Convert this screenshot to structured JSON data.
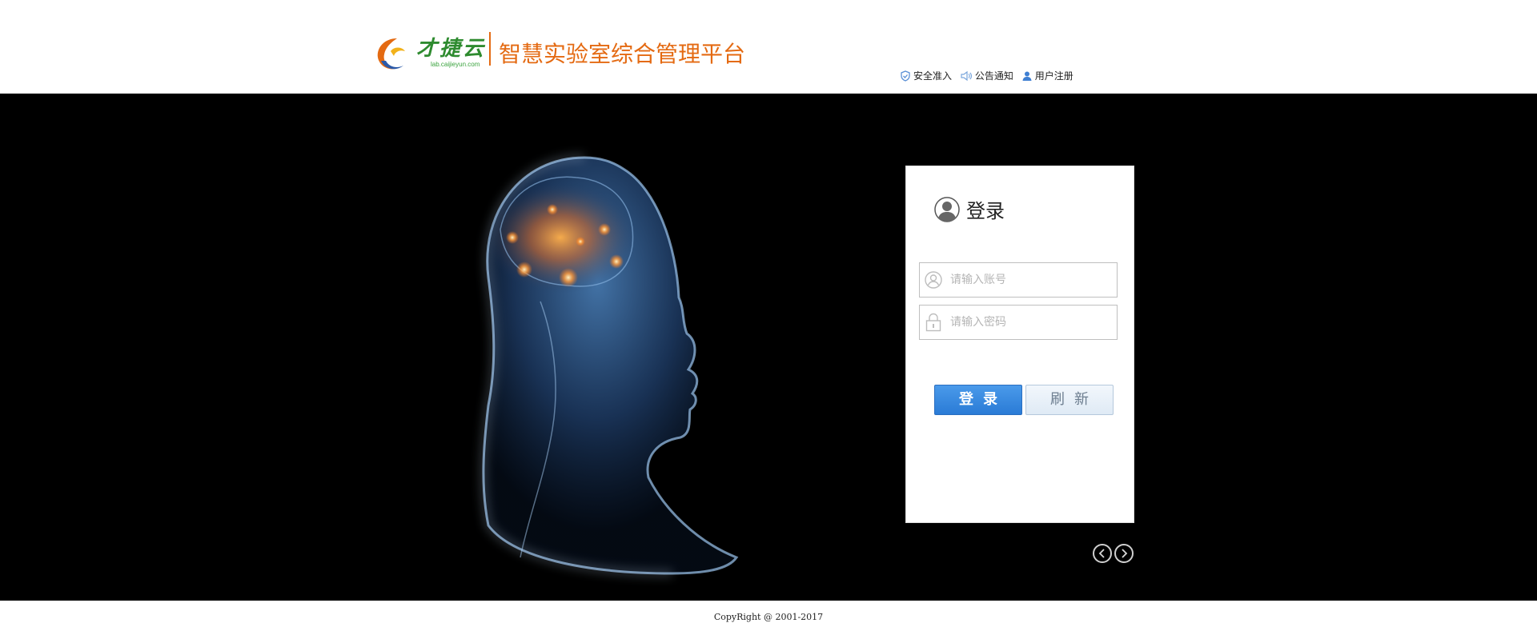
{
  "header": {
    "brand_name": "才捷云",
    "brand_url": "lab.caijieyun.com",
    "platform_title": "智慧实验室综合管理平台",
    "links": [
      {
        "label": "安全准入",
        "icon": "shield-check-icon"
      },
      {
        "label": "公告通知",
        "icon": "speaker-icon"
      },
      {
        "label": "用户注册",
        "icon": "user-icon"
      }
    ]
  },
  "login": {
    "title": "登录",
    "username_placeholder": "请输入账号",
    "username_value": "",
    "password_placeholder": "请输入密码",
    "password_value": "",
    "login_button": "登录",
    "refresh_button": "刷新"
  },
  "carousel": {
    "prev_icon": "chevron-left-icon",
    "next_icon": "chevron-right-icon"
  },
  "footer": {
    "copyright": "CopyRight @ 2001-2017"
  },
  "colors": {
    "accent_orange": "#e46a12",
    "brand_green": "#2e8b2f",
    "login_blue": "#2a7bd6",
    "hero_bg": "#000000"
  }
}
